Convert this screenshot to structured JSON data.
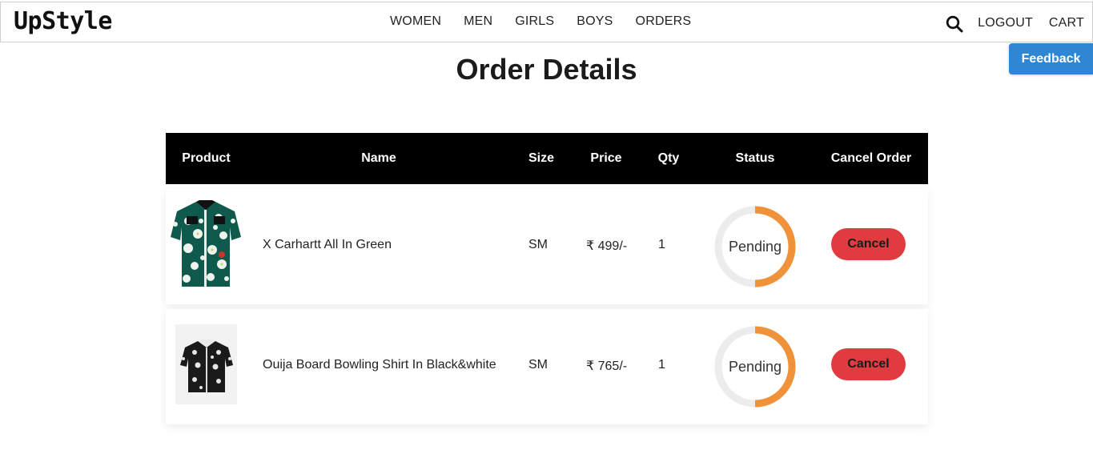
{
  "nav": {
    "brand": "UpStyle",
    "links": [
      "WOMEN",
      "MEN",
      "GIRLS",
      "BOYS",
      "ORDERS"
    ],
    "right": {
      "search_icon": "search-icon",
      "logout": "LOGOUT",
      "cart": "CART"
    }
  },
  "feedback_label": "Feedback",
  "page_title": "Order Details",
  "table": {
    "headers": [
      "Product",
      "Name",
      "Size",
      "Price",
      "Qty",
      "Status",
      "Cancel Order"
    ],
    "rows": [
      {
        "product_image": "green-floral-shirt",
        "name": "X Carhartt All In Green",
        "size": "SM",
        "price": "₹ 499/-",
        "qty": "1",
        "status": "Pending",
        "cancel": "Cancel"
      },
      {
        "product_image": "black-bandana-shirt",
        "name": "Ouija Board Bowling Shirt In Black&white",
        "size": "SM",
        "price": "₹ 765/-",
        "qty": "1",
        "status": "Pending",
        "cancel": "Cancel"
      }
    ]
  },
  "colors": {
    "header_bg": "#000000",
    "status_ring": "#f0923a",
    "status_track": "#ececec",
    "cancel_bg": "#e03c40",
    "feedback_bg": "#2f86d3"
  }
}
